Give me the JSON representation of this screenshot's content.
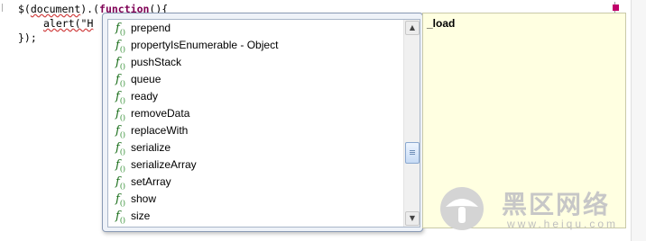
{
  "editor": {
    "lines": [
      {
        "parts": [
          "$(",
          "document",
          ").(",
          "function",
          "(){"
        ]
      },
      {
        "text": "alert(\"H"
      },
      {
        "text": "});"
      }
    ]
  },
  "content_assist": {
    "items": [
      {
        "label": "prepend"
      },
      {
        "label": "propertyIsEnumerable - Object"
      },
      {
        "label": "pushStack"
      },
      {
        "label": "queue"
      },
      {
        "label": "ready"
      },
      {
        "label": "removeData"
      },
      {
        "label": "replaceWith"
      },
      {
        "label": "serialize"
      },
      {
        "label": "serializeArray"
      },
      {
        "label": "setArray"
      },
      {
        "label": "show"
      },
      {
        "label": "size"
      }
    ],
    "icon_glyph": "f",
    "icon_sub": "()"
  },
  "doc_popup": {
    "text": "_load"
  },
  "watermark": {
    "chinese": "黑区网络",
    "url": "www.heiqu.com"
  },
  "colors": {
    "keyword": "#7f0055",
    "string": "#2a00ff",
    "doc_background": "#ffffe1",
    "function_icon": "#1a6e1a"
  }
}
